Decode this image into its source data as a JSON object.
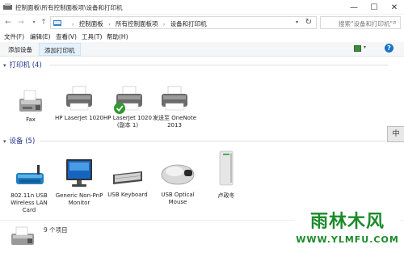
{
  "window": {
    "title": "控制面板\\所有控制面板项\\设备和打印机",
    "min": "—",
    "max": "☐",
    "close": "✕"
  },
  "address": {
    "breadcrumbs": [
      "控制面板",
      "所有控制面板项",
      "设备和打印机"
    ],
    "search_placeholder": "搜索\"设备和打印机\""
  },
  "menu": [
    "文件(F)",
    "编辑(E)",
    "查看(V)",
    "工具(T)",
    "帮助(H)"
  ],
  "commands": {
    "add_device": "添加设备",
    "add_printer": "添加打印机"
  },
  "printers": {
    "header": "打印机 (4)",
    "items": [
      {
        "label": "Fax",
        "icon": "fax-icon"
      },
      {
        "label": "HP LaserJet 1020",
        "icon": "printer-icon"
      },
      {
        "label": "HP LaserJet 1020 (副本 1)",
        "icon": "default-printer-icon",
        "default": true
      },
      {
        "label": "发送至 OneNote 2013",
        "icon": "printer-icon"
      }
    ]
  },
  "devices": {
    "header": "设备 (5)",
    "items": [
      {
        "label": "802.11n USB Wireless LAN Card",
        "icon": "wireless-adapter-icon"
      },
      {
        "label": "Generic Non-PnP Monitor",
        "icon": "monitor-icon"
      },
      {
        "label": "USB Keyboard",
        "icon": "keyboard-icon"
      },
      {
        "label": "USB Optical Mouse",
        "icon": "mouse-icon"
      },
      {
        "label": "卢政冬",
        "icon": "computer-tower-icon"
      }
    ]
  },
  "status": {
    "count": "9 个项目"
  },
  "side_tab": "中",
  "watermark": {
    "top": "雨林木风",
    "bottom": "WWW.YLMFU.COM"
  },
  "colors": {
    "section_header": "#1e3287",
    "default_check": "#2e9b2e",
    "watermark": "#1b8a2a"
  }
}
